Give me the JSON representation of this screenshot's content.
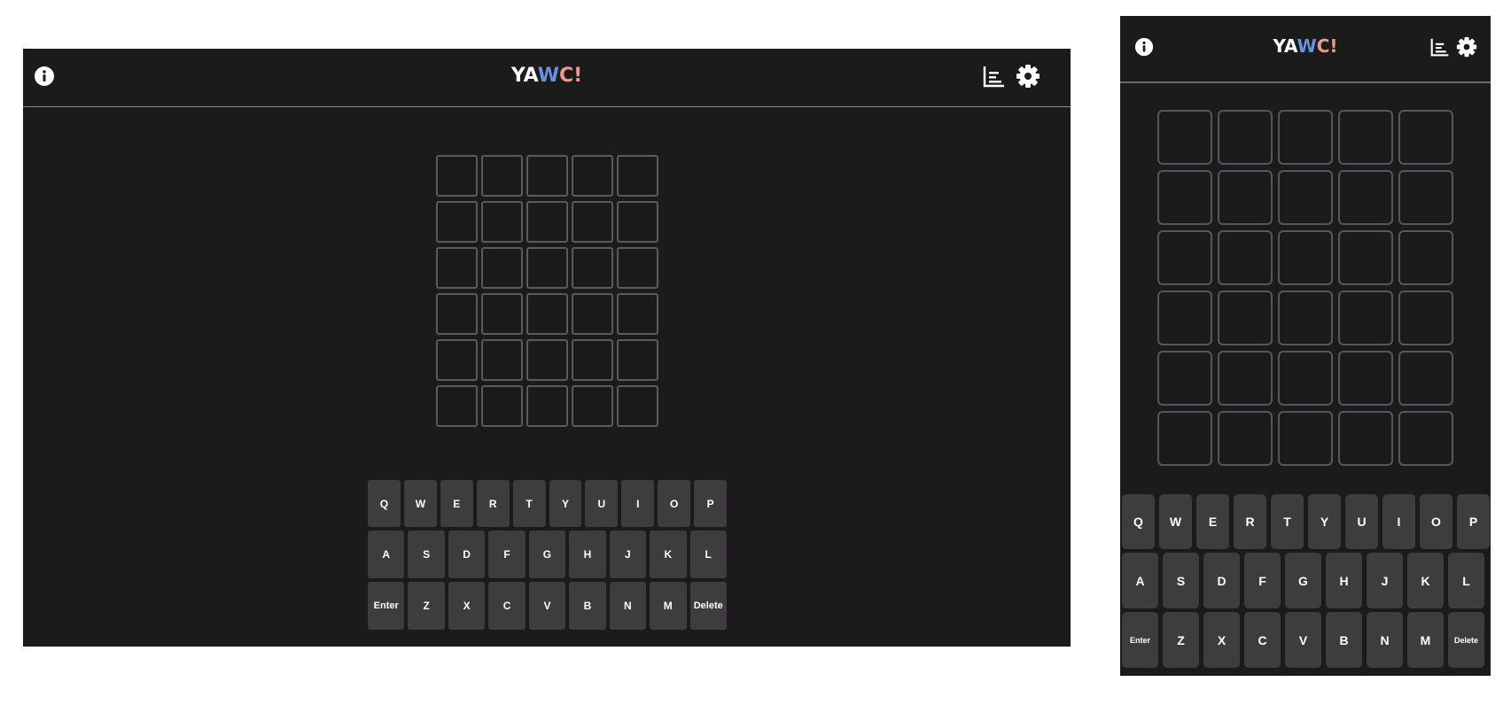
{
  "app": {
    "logo": {
      "part1": "YA",
      "part2": "W",
      "part3": "C!"
    },
    "colors": {
      "background": "#1c1b1c",
      "tile_border": "#5c5a5e",
      "key": "#3f3c3f",
      "logo_w": "#6a8fe0",
      "logo_c": "#e89a8e"
    },
    "icons": {
      "left": "info-icon",
      "right": [
        "stats-chart-icon",
        "gear-icon"
      ]
    }
  },
  "board": {
    "rows": 6,
    "cols": 5
  },
  "keyboard": {
    "row1": [
      "Q",
      "W",
      "E",
      "R",
      "T",
      "Y",
      "U",
      "I",
      "O",
      "P"
    ],
    "row2": [
      "A",
      "S",
      "D",
      "F",
      "G",
      "H",
      "J",
      "K",
      "L"
    ],
    "row3": [
      "Enter",
      "Z",
      "X",
      "C",
      "V",
      "B",
      "N",
      "M",
      "Delete"
    ]
  }
}
